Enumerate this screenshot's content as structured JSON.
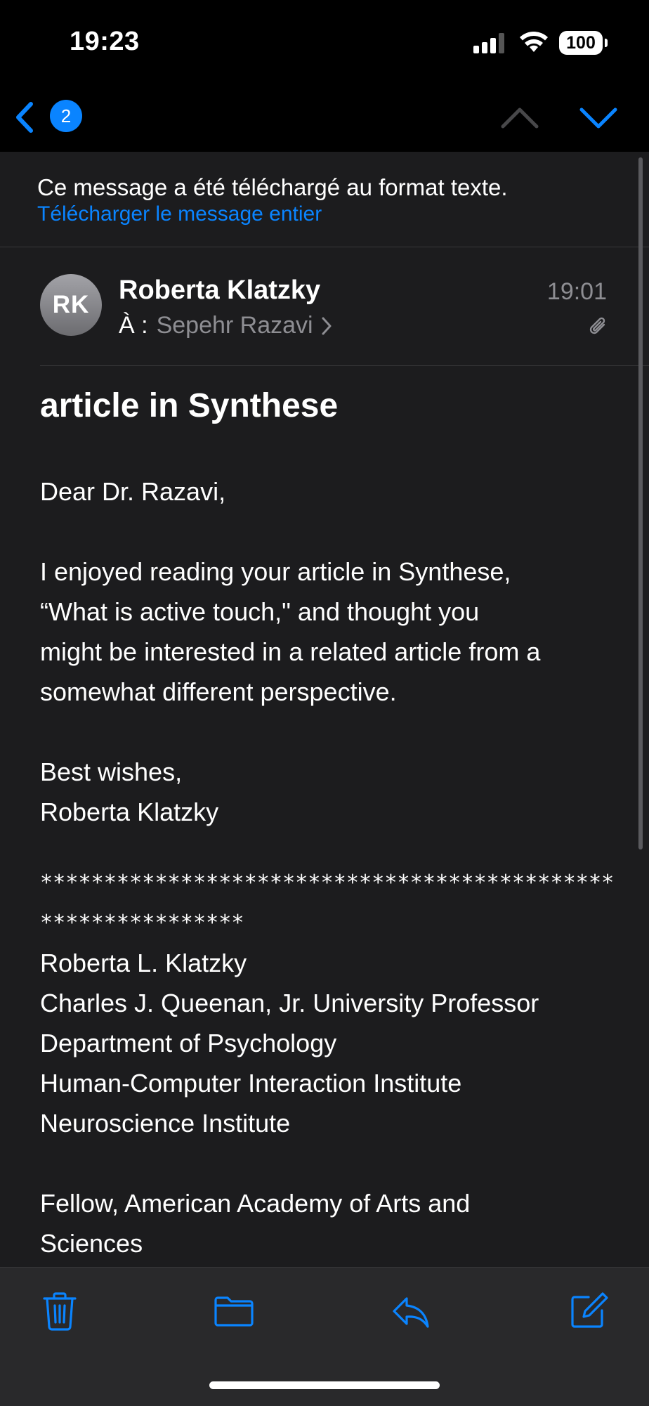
{
  "status_bar": {
    "time": "19:23",
    "battery": "100"
  },
  "nav": {
    "unread_count": "2"
  },
  "banner": {
    "text": "Ce message a été téléchargé au format texte.",
    "link": "Télécharger le message entier"
  },
  "header": {
    "avatar_initials": "RK",
    "sender": "Roberta Klatzky",
    "to_label": "À :",
    "recipient": "Sepehr Razavi",
    "time": "19:01"
  },
  "subject": "article in Synthese",
  "body": {
    "greeting": "Dear Dr. Razavi,",
    "paragraph_lines": [
      "I enjoyed reading your article in Synthese,",
      "“What is active touch,\" and thought you",
      "might be interested in a related article from a",
      "somewhat different perspective."
    ],
    "closing": "Best wishes,",
    "sign_name": "Roberta Klatzky",
    "separator": "*************************************************************",
    "signature_lines": [
      "Roberta L. Klatzky",
      "Charles J. Queenan, Jr. University Professor",
      "Department of Psychology",
      "Human-Computer Interaction Institute",
      "Neuroscience Institute"
    ],
    "fellow_lines": [
      "Fellow, American Academy of Arts and",
      "Sciences"
    ]
  },
  "icons": {
    "back": "chevron-left-icon",
    "prev": "chevron-up-icon",
    "next": "chevron-down-icon",
    "attachment": "paperclip-icon",
    "trash": "trash-icon",
    "folder": "folder-icon",
    "reply": "reply-icon",
    "compose": "compose-icon"
  },
  "colors": {
    "accent": "#0a84ff",
    "background": "#1c1c1e",
    "secondary_text": "#8e8e93"
  }
}
